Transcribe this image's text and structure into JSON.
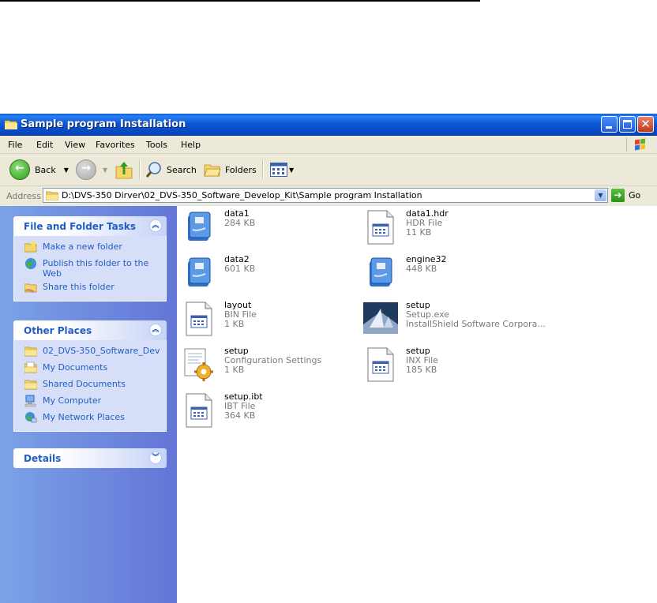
{
  "window": {
    "title": "Sample program Installation"
  },
  "menu": [
    "File",
    "Edit",
    "View",
    "Favorites",
    "Tools",
    "Help"
  ],
  "toolbar": {
    "back_label": "Back",
    "search_label": "Search",
    "folders_label": "Folders"
  },
  "address": {
    "label": "Address",
    "path": "D:\\DVS-350 Dirver\\02_DVS-350_Software_Develop_Kit\\Sample program Installation",
    "go_label": "Go"
  },
  "file_tasks": {
    "title": "File and Folder Tasks",
    "items": [
      {
        "label": "Make a new folder",
        "icon": "new-folder-icon"
      },
      {
        "label": "Publish this folder to the Web",
        "icon": "globe-icon"
      },
      {
        "label": "Share this folder",
        "icon": "share-folder-icon"
      }
    ]
  },
  "other_places": {
    "title": "Other Places",
    "items": [
      {
        "label": "02_DVS-350_Software_Dev",
        "icon": "folder-icon"
      },
      {
        "label": "My Documents",
        "icon": "my-documents-icon"
      },
      {
        "label": "Shared Documents",
        "icon": "folder-icon"
      },
      {
        "label": "My Computer",
        "icon": "my-computer-icon"
      },
      {
        "label": "My Network Places",
        "icon": "network-icon"
      }
    ]
  },
  "details": {
    "title": "Details"
  },
  "files": [
    {
      "name": "data1",
      "type": "",
      "size": "284 KB",
      "icon": "cab-archive-icon"
    },
    {
      "name": "data1.hdr",
      "type": "HDR File",
      "size": "11 KB",
      "icon": "generic-file-icon"
    },
    {
      "name": "data2",
      "type": "",
      "size": "601 KB",
      "icon": "cab-archive-icon"
    },
    {
      "name": "engine32",
      "type": "",
      "size": "448 KB",
      "icon": "cab-archive-icon"
    },
    {
      "name": "layout",
      "type": "BIN File",
      "size": "1 KB",
      "icon": "generic-file-icon"
    },
    {
      "name": "setup",
      "type": "Setup.exe",
      "size": "InstallShield Software Corpora...",
      "icon": "installshield-icon"
    },
    {
      "name": "setup",
      "type": "Configuration Settings",
      "size": "1 KB",
      "icon": "config-settings-icon"
    },
    {
      "name": "setup",
      "type": "INX File",
      "size": "185 KB",
      "icon": "generic-file-icon"
    },
    {
      "name": "setup.ibt",
      "type": "IBT File",
      "size": "364 KB",
      "icon": "generic-file-icon"
    }
  ],
  "colors": {
    "titlebar": "#0b58d6",
    "taskpane": "#6f8ee0",
    "link": "#215dc6"
  }
}
